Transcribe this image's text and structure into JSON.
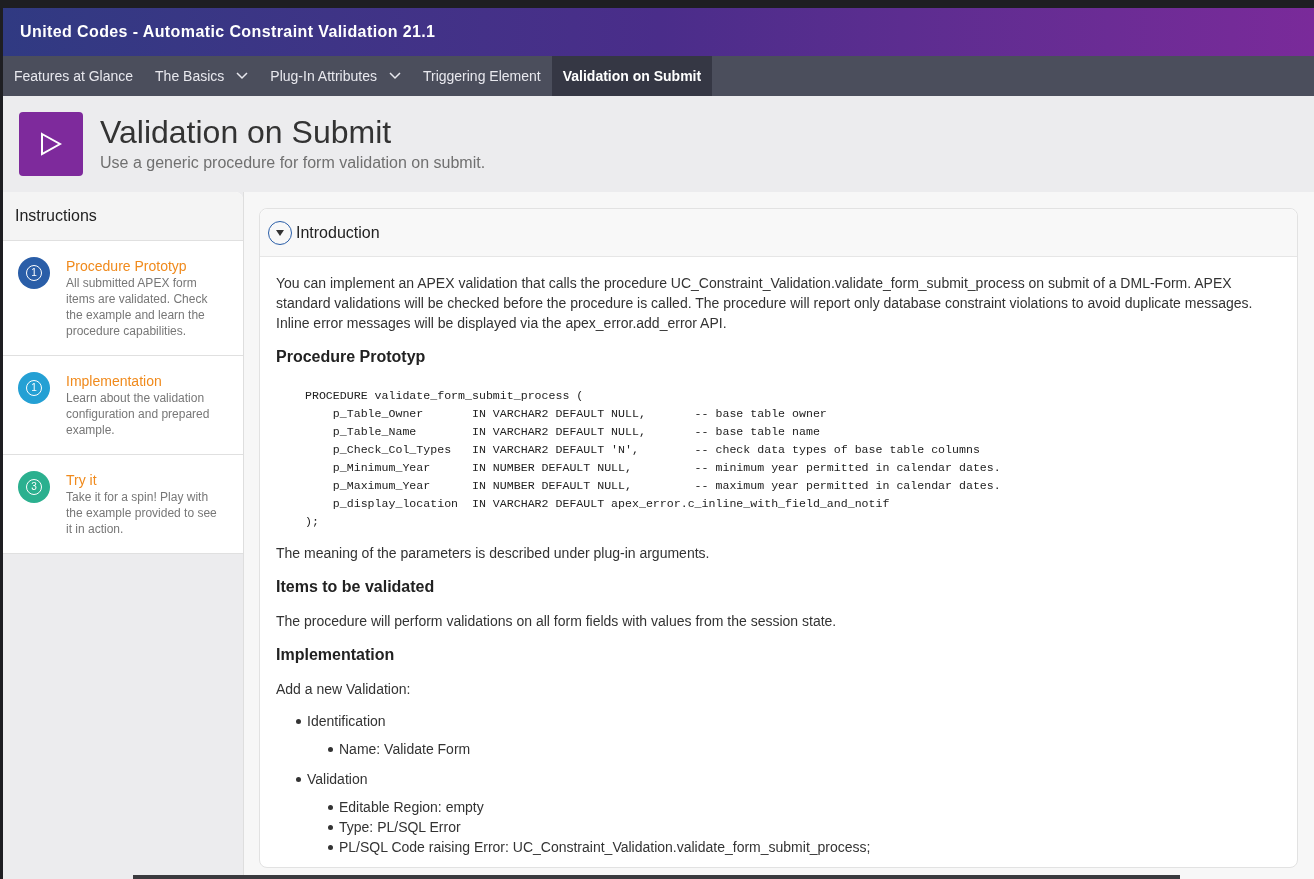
{
  "app_title": "United Codes - Automatic Constraint Validation 21.1",
  "nav": [
    {
      "label": "Features at Glance",
      "dropdown": false,
      "selected": false
    },
    {
      "label": "The Basics",
      "dropdown": true,
      "selected": false
    },
    {
      "label": "Plug-In Attributes",
      "dropdown": true,
      "selected": false
    },
    {
      "label": "Triggering Element",
      "dropdown": false,
      "selected": false
    },
    {
      "label": "Validation on Submit",
      "dropdown": false,
      "selected": true
    }
  ],
  "hero": {
    "title": "Validation on Submit",
    "subtitle": "Use a generic procedure for form validation on submit."
  },
  "sidebar": {
    "title": "Instructions",
    "steps": [
      {
        "number": "1",
        "color": "#2a5ea8",
        "title": "Procedure Prototyp",
        "description": "All submitted APEX form items are validated. Check the example and learn the procedure capabilities."
      },
      {
        "number": "1",
        "color": "#24a0d4",
        "title": "Implementation",
        "description": "Learn about the validation configuration and prepared example."
      },
      {
        "number": "3",
        "color": "#2bb08f",
        "title": "Try it",
        "description": "Take it for a spin! Play with the example provided to see it in action."
      }
    ]
  },
  "region": {
    "title": "Introduction",
    "expanded": true,
    "blocks": [
      {
        "kind": "paragraph",
        "text": "You can implement an APEX validation that calls the procedure UC_Constraint_Validation.validate_form_submit_process on submit of a DML-Form. APEX standard validations will be checked before the procedure is called. The procedure will report only database constraint violations to avoid duplicate messages. Inline error messages will be displayed via the apex_error.add_error API."
      },
      {
        "kind": "heading",
        "text": "Procedure Prototyp"
      },
      {
        "kind": "code",
        "lines": [
          "PROCEDURE validate_form_submit_process (",
          "    p_Table_Owner       IN VARCHAR2 DEFAULT NULL,       -- base table owner",
          "    p_Table_Name        IN VARCHAR2 DEFAULT NULL,       -- base table name",
          "    p_Check_Col_Types   IN VARCHAR2 DEFAULT 'N',        -- check data types of base table columns",
          "    p_Minimum_Year      IN NUMBER DEFAULT NULL,         -- minimum year permitted in calendar dates.",
          "    p_Maximum_Year      IN NUMBER DEFAULT NULL,         -- maximum year permitted in calendar dates.",
          "    p_display_location  IN VARCHAR2 DEFAULT apex_error.c_inline_with_field_and_notif",
          ");"
        ]
      },
      {
        "kind": "paragraph",
        "text": "The meaning of the parameters is described under plug-in arguments."
      },
      {
        "kind": "heading",
        "text": "Items to be validated"
      },
      {
        "kind": "paragraph",
        "text": "The procedure will perform validations on all form fields with values from the session state."
      },
      {
        "kind": "heading",
        "text": "Implementation"
      },
      {
        "kind": "paragraph",
        "text": "Add a new Validation:"
      },
      {
        "kind": "list",
        "items": [
          {
            "text": "Identification",
            "children": [
              {
                "text": "Name: Validate Form"
              }
            ]
          },
          {
            "text": "Validation",
            "children": [
              {
                "text": "Editable Region: empty"
              },
              {
                "text": "Type: PL/SQL Error"
              },
              {
                "text": "PL/SQL Code raising Error: UC_Constraint_Validation.validate_form_submit_process;"
              }
            ]
          }
        ]
      }
    ]
  }
}
